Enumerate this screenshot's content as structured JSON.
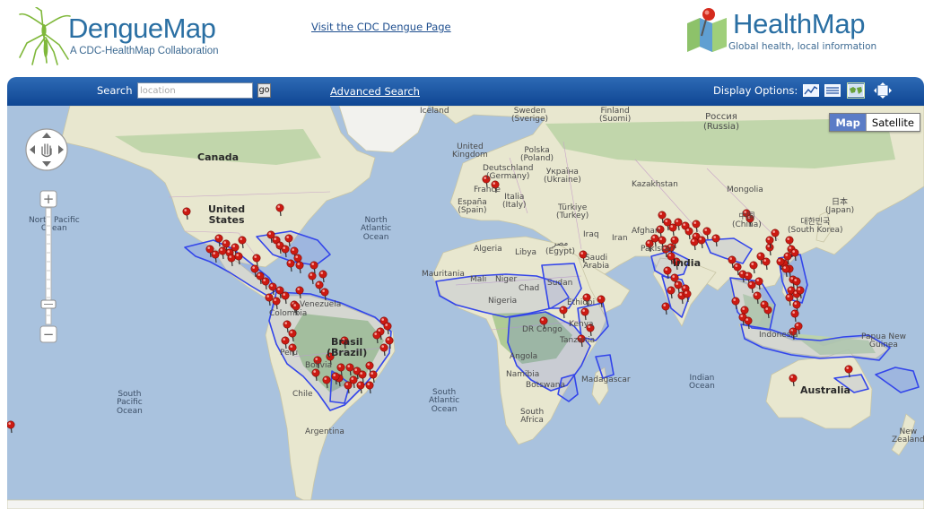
{
  "header": {
    "dengue_title": "DengueMap",
    "dengue_tagline": "A CDC-HealthMap Collaboration",
    "cdc_link": "Visit the CDC Dengue Page",
    "healthmap_title": "HealthMap",
    "healthmap_tagline": "Global health, local information"
  },
  "toolbar": {
    "search_label": "Search",
    "search_placeholder": "location",
    "search_value": "",
    "go_label": "go",
    "advanced_search": "Advanced Search",
    "display_label": "Display Options:",
    "display_icons": [
      "chart-icon",
      "list-icon",
      "map-icon",
      "fullscreen-icon"
    ]
  },
  "map": {
    "map_button": "Map",
    "satellite_button": "Satellite",
    "active_type": "Map",
    "colors": {
      "water": "#a9c2de",
      "land": "#e8e7cf",
      "forest": "#bdd4a6",
      "outbreak_outline": "#3345ea",
      "marker": "#cc1a12"
    },
    "labels": {
      "iceland": "Iceland",
      "sweden": "Sweden\n(Sverige)",
      "finland": "Finland\n(Suomi)",
      "russia": "Россия\n(Russia)",
      "uk": "United\nKingdom",
      "poland": "Polska\n(Poland)",
      "germany": "Deutschland\n(Germany)",
      "ukraine": "Україна\n(Ukraine)",
      "kazakhstan": "Kazakhstan",
      "mongolia": "Mongolia",
      "france": "France",
      "spain": "España\n(Spain)",
      "italy": "Italia\n(Italy)",
      "turkey": "Türkiye\n(Turkey)",
      "china": "中国\n(China)",
      "japan": "日本\n(Japan)",
      "south_korea": "대한민국\n(South Korea)",
      "iraq": "Iraq",
      "iran": "Iran",
      "afghanistan": "Afghan",
      "pakistan": "Pakistan",
      "india": "India",
      "algeria": "Algeria",
      "libya": "Libya",
      "egypt": "مصر\n(Egypt)",
      "saudi": "Saudi\nArabia",
      "mauritania": "Mauritania",
      "mali": "Mali",
      "niger": "Niger",
      "chad": "Chad",
      "sudan": "Sudan",
      "ethiopia": "Ethiopi",
      "nigeria": "Nigeria",
      "dr_congo": "DR Congo",
      "kenya": "Kenya",
      "tanzania": "Tanzania",
      "angola": "Angola",
      "namibia": "Namibia",
      "botswana": "Botswana",
      "madagascar": "Madagascar",
      "south_africa": "South\nAfrica",
      "canada": "Canada",
      "united_states": "United\nStates",
      "venezuela": "Venezuela",
      "colombia": "Colombia",
      "peru": "Peru",
      "bolivia": "Bolivia",
      "brazil": "Brasil\n(Brazil)",
      "chile": "Chile",
      "argentina": "Argentina",
      "indonesia": "Indonesia",
      "papua": "Papua New\nGuinea",
      "australia": "Australia",
      "new_zealand": "New\nZealand",
      "north_pacific": "North Pacific\nOcean",
      "north_atlantic": "North\nAtlantic\nOcean",
      "south_pacific": "South\nPacific\nOcean",
      "south_atlantic": "South\nAtlantic\nOcean",
      "indian_ocean": "Indian\nOcean"
    }
  }
}
